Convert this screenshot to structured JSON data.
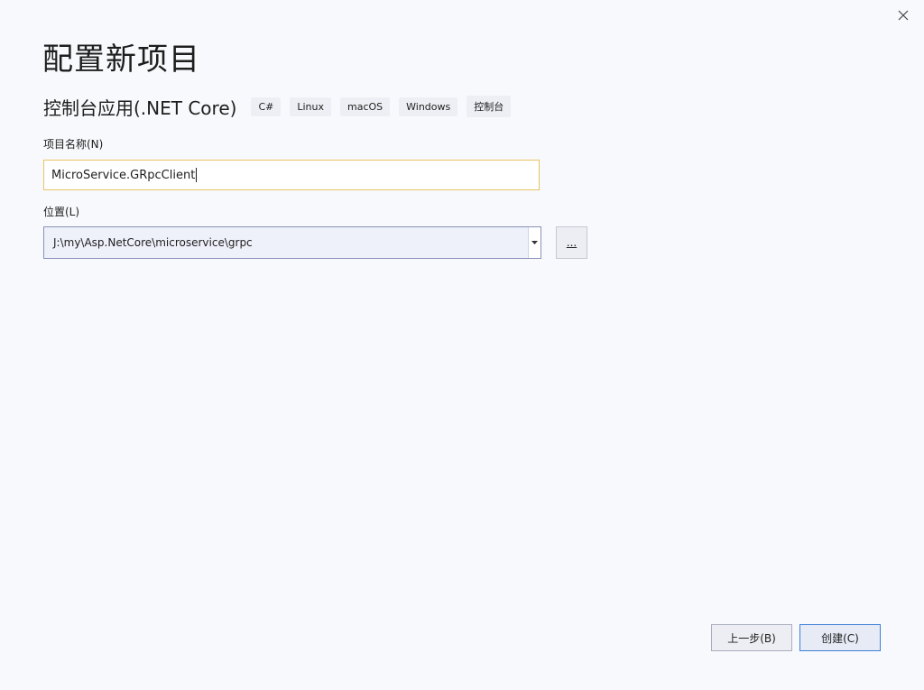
{
  "dialog": {
    "title": "配置新项目",
    "template_name": "控制台应用(.NET Core)",
    "tags": [
      "C#",
      "Linux",
      "macOS",
      "Windows",
      "控制台"
    ]
  },
  "project_name": {
    "label": "项目名称(N)",
    "value": "MicroService.GRpcClient"
  },
  "location": {
    "label": "位置(L)",
    "value": "J:\\my\\Asp.NetCore\\microservice\\grpc",
    "browse_label": "..."
  },
  "buttons": {
    "back_label": "上一步(B)",
    "create_label": "创建(C)"
  },
  "icons": {
    "close": "close-icon",
    "dropdown": "chevron-down-icon"
  }
}
